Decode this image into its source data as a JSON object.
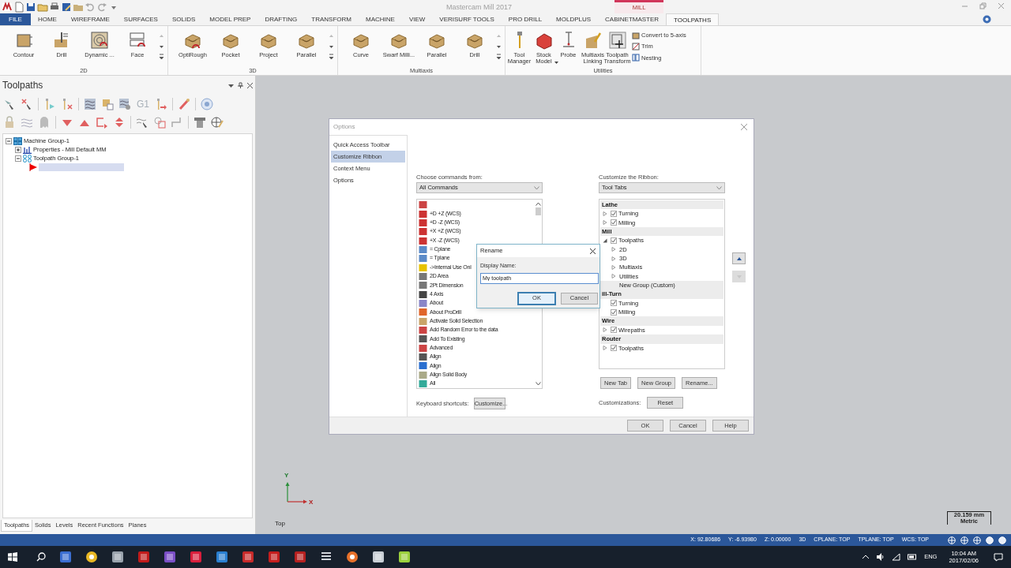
{
  "title_bar": {
    "title": "Mastercam Mill 2017",
    "context_label": "MILL"
  },
  "menu_tabs": [
    {
      "label": "FILE",
      "kind": "file",
      "selected": false
    },
    {
      "label": "HOME",
      "kind": "tab",
      "selected": false
    },
    {
      "label": "WIREFRAME",
      "kind": "tab",
      "selected": false
    },
    {
      "label": "SURFACES",
      "kind": "tab",
      "selected": false
    },
    {
      "label": "SOLIDS",
      "kind": "tab",
      "selected": false
    },
    {
      "label": "MODEL PREP",
      "kind": "tab",
      "selected": false
    },
    {
      "label": "DRAFTING",
      "kind": "tab",
      "selected": false
    },
    {
      "label": "TRANSFORM",
      "kind": "tab",
      "selected": false
    },
    {
      "label": "MACHINE",
      "kind": "tab",
      "selected": false
    },
    {
      "label": "VIEW",
      "kind": "tab",
      "selected": false
    },
    {
      "label": "VERISURF TOOLS",
      "kind": "tab",
      "selected": false
    },
    {
      "label": "PRO DRILL",
      "kind": "tab",
      "selected": false
    },
    {
      "label": "MOLDPLUS",
      "kind": "tab",
      "selected": false
    },
    {
      "label": "CABINETMASTER",
      "kind": "tab",
      "selected": false
    },
    {
      "label": "TOOLPATHS",
      "kind": "tab",
      "selected": true
    }
  ],
  "ribbon_groups": [
    {
      "label": "2D",
      "buttons": [
        {
          "label": "Contour"
        },
        {
          "label": "Drill"
        },
        {
          "label": "Dynamic ..."
        },
        {
          "label": "Face"
        }
      ]
    },
    {
      "label": "3D",
      "buttons": [
        {
          "label": "OptiRough"
        },
        {
          "label": "Pocket"
        },
        {
          "label": "Project"
        },
        {
          "label": "Parallel"
        }
      ]
    },
    {
      "label": "Multiaxis",
      "buttons": [
        {
          "label": "Curve"
        },
        {
          "label": "Swarf Milli..."
        },
        {
          "label": "Parallel"
        },
        {
          "label": "Drill"
        }
      ]
    },
    {
      "label": "Utilities",
      "buttons": [
        {
          "label": "Tool Manager"
        },
        {
          "label": "Stock Model",
          "dropdown": true
        },
        {
          "label": "Probe"
        },
        {
          "label": "Multiaxis Linking"
        },
        {
          "label": "Toolpath Transform"
        }
      ],
      "small_buttons": [
        "Convert to 5-axis",
        "Trim",
        "Nesting"
      ]
    }
  ],
  "panel": {
    "title": "Toolpaths",
    "toolbar_text": "G1",
    "tree": [
      {
        "kind": "machine-group",
        "label": "Machine Group-1",
        "expanded": true,
        "children": [
          {
            "kind": "properties",
            "label": "Properties - Mill Default MM",
            "expanded": false
          },
          {
            "kind": "toolpath-group",
            "label": "Toolpath Group-1",
            "expanded": true,
            "children": [
              {
                "kind": "insert-arrow",
                "selected": true
              }
            ]
          }
        ]
      }
    ],
    "bottom_tabs": [
      {
        "label": "Toolpaths",
        "selected": true
      },
      {
        "label": "Solids",
        "selected": false
      },
      {
        "label": "Levels",
        "selected": false
      },
      {
        "label": "Recent Functions",
        "selected": false
      },
      {
        "label": "Planes",
        "selected": false
      }
    ]
  },
  "viewport": {
    "axis_x": "X",
    "axis_y": "Y",
    "view_label": "Top",
    "scale": "20.159 mm",
    "units": "Metric"
  },
  "options_dialog": {
    "title": "Options",
    "nav": [
      {
        "label": "Quick Access Toolbar",
        "selected": false
      },
      {
        "label": "Customize Ribbon",
        "selected": true
      },
      {
        "label": "Context Menu",
        "selected": false
      },
      {
        "label": "Options",
        "selected": false
      }
    ],
    "commands_label": "Choose commands from:",
    "commands_source": "All Commands",
    "commands": [
      {
        "kind": "icon-only"
      },
      {
        "kind": "command",
        "label": "+D +Z (WCS)"
      },
      {
        "kind": "command",
        "label": "+D -Z (WCS)"
      },
      {
        "kind": "command",
        "label": "+X +Z (WCS)"
      },
      {
        "kind": "command",
        "label": "+X -Z (WCS)"
      },
      {
        "kind": "command",
        "label": "= Cplane"
      },
      {
        "kind": "command",
        "label": "= Tplane"
      },
      {
        "kind": "command",
        "label": "->Internal Use Onl"
      },
      {
        "kind": "command",
        "label": "2D Area"
      },
      {
        "kind": "command",
        "label": "2Pt Dimension"
      },
      {
        "kind": "command",
        "label": "4 Axis"
      },
      {
        "kind": "command",
        "label": "About"
      },
      {
        "kind": "command",
        "label": "About ProDrill"
      },
      {
        "kind": "command",
        "label": "Activate Solid Selection"
      },
      {
        "kind": "command",
        "label": "Add Random Error to the data"
      },
      {
        "kind": "command",
        "label": "Add To Existing"
      },
      {
        "kind": "command",
        "label": "Advanced"
      },
      {
        "kind": "command",
        "label": "Align"
      },
      {
        "kind": "command",
        "label": "Align"
      },
      {
        "kind": "command",
        "label": "Align Solid Body"
      },
      {
        "kind": "command",
        "label": "All"
      }
    ],
    "keyboard_label": "Keyboard shortcuts:",
    "customize_button": "Customize...",
    "ribbon_label": "Customize the Ribbon:",
    "ribbon_source": "Tool Tabs",
    "ribbon_tree": [
      {
        "label": "Lathe",
        "children": [
          {
            "label": "Turning",
            "checked": true,
            "expanded": false
          },
          {
            "label": "Milling",
            "checked": true,
            "expanded": false
          }
        ]
      },
      {
        "label": "Mill",
        "children": [
          {
            "label": "Toolpaths",
            "checked": true,
            "expanded": true,
            "children": [
              {
                "label": "2D",
                "expanded": false,
                "selected": false
              },
              {
                "label": "3D",
                "expanded": false,
                "selected": false
              },
              {
                "label": "Multiaxis",
                "expanded": false,
                "selected": false
              },
              {
                "label": "Utilities",
                "expanded": false,
                "selected": false
              },
              {
                "label": "New Group (Custom)",
                "selected": true
              }
            ]
          }
        ]
      },
      {
        "label": "ill-Turn",
        "children": [
          {
            "label": "Turning",
            "checked": true
          },
          {
            "label": "Milling",
            "checked": true
          }
        ]
      },
      {
        "label": "Wire",
        "children": [
          {
            "label": "Wirepaths",
            "checked": true,
            "expanded": false
          }
        ]
      },
      {
        "label": "Router",
        "children": [
          {
            "label": "Toolpaths",
            "checked": true,
            "expanded": false
          }
        ]
      }
    ],
    "move_buttons": [
      {
        "disabled": false
      },
      {
        "disabled": true
      }
    ],
    "tree_buttons": [
      "New Tab",
      "New Group",
      "Rename..."
    ],
    "customizations_label": "Customizations:",
    "reset_button": "Reset",
    "footer_buttons": [
      "OK",
      "Cancel",
      "Help"
    ]
  },
  "rename_dialog": {
    "title": "Rename",
    "label": "Display Name:",
    "value": "My toolpath",
    "buttons": [
      {
        "label": "OK",
        "default": true
      },
      {
        "label": "Cancel",
        "default": false
      }
    ]
  },
  "status_bar": [
    "X: 92.80686",
    "Y: -6.93980",
    "Z: 0.00000",
    "3D",
    "CPLANE: TOP",
    "TPLANE: TOP",
    "WCS: TOP"
  ],
  "taskbar": {
    "language": "ENG",
    "time": "10:04 AM",
    "date": "2017/02/06"
  }
}
